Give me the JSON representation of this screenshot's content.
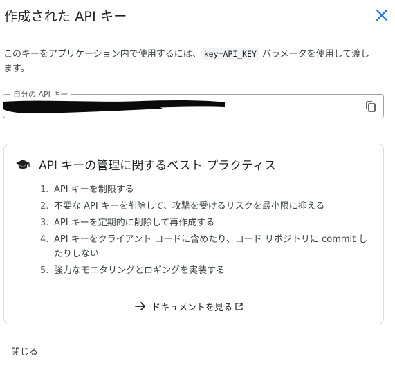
{
  "dialog": {
    "title": "作成された API キー",
    "close_icon": "close-icon"
  },
  "description": {
    "before": "このキーをアプリケーション内で使用するには、",
    "code": "key=API_KEY",
    "after": " パラメータを使用して渡します。"
  },
  "api_key_field": {
    "label": "自分の API キー",
    "value_redacted": true,
    "copy_icon": "copy-icon"
  },
  "best_practices": {
    "icon": "graduation-cap-icon",
    "title": "API キーの管理に関するベスト プラクティス",
    "items": [
      {
        "num": "1.",
        "text": "API キーを制限する"
      },
      {
        "num": "2.",
        "text": "不要な API キーを削除して、攻撃を受けるリスクを最小限に抑える"
      },
      {
        "num": "3.",
        "text": "API キーを定期的に削除して再作成する"
      },
      {
        "num": "4.",
        "text": "API キーをクライアント コードに含めたり、コード リポジトリに commit したりしない"
      },
      {
        "num": "5.",
        "text": "強力なモニタリングとロギングを実装する"
      }
    ],
    "doc_link": "ドキュメントを見る"
  },
  "footer": {
    "close_label": "閉じる"
  },
  "colors": {
    "accent": "#1a73e8",
    "text_primary": "#202124",
    "text_secondary": "#3c4043",
    "border": "#dadce0"
  }
}
